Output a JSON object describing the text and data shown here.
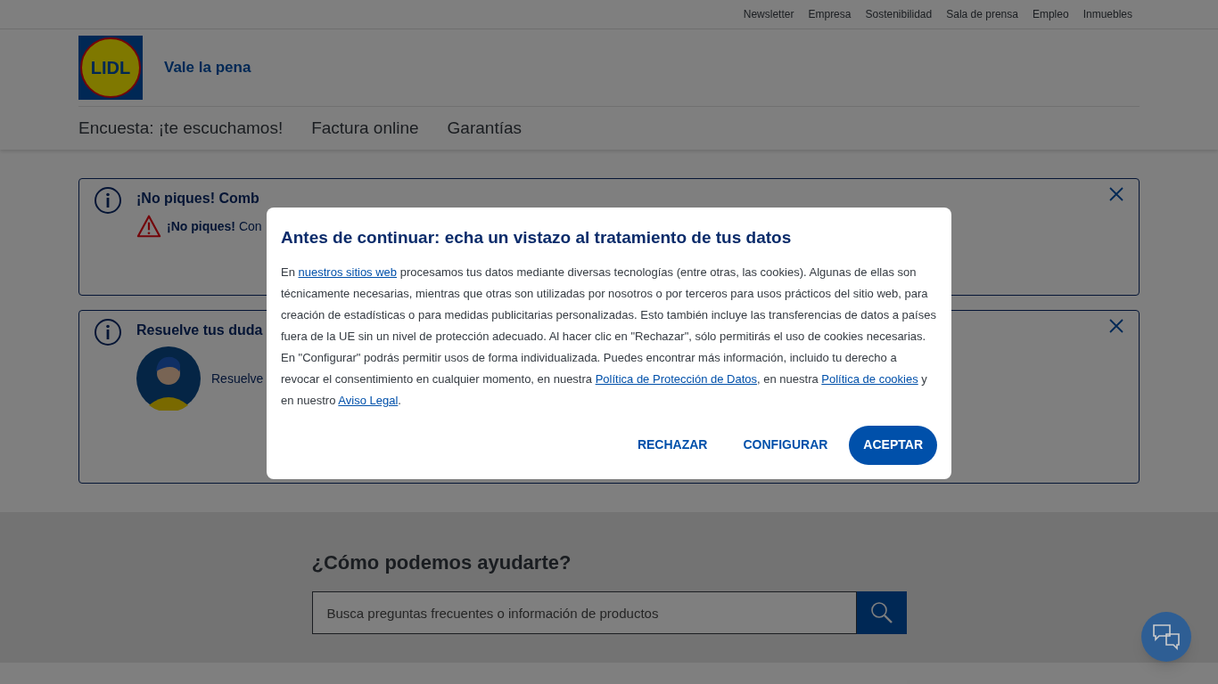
{
  "top_links": [
    "Newsletter",
    "Empresa",
    "Sostenibilidad",
    "Sala de prensa",
    "Empleo",
    "Inmuebles"
  ],
  "logo": {
    "text": "LIDL"
  },
  "tagline": "Vale la pena",
  "nav": [
    "Encuesta: ¡te escuchamos!",
    "Factura online",
    "Garantías"
  ],
  "notices": [
    {
      "kind": "warning",
      "title": "¡No piques! Comb",
      "lead": "¡No piques!",
      "text": "Con"
    },
    {
      "kind": "avatar",
      "title": "Resuelve tus duda",
      "text": "Resuelve"
    }
  ],
  "help": {
    "title": "¿Cómo podemos ayudarte?",
    "placeholder": "Busca preguntas frecuentes o información de productos"
  },
  "dialog": {
    "title": "Antes de continuar: echa un vistazo al tratamiento de tus datos",
    "body": [
      {
        "kind": "text",
        "text": "En "
      },
      {
        "kind": "link",
        "text": "nuestros sitios web"
      },
      {
        "kind": "text",
        "text": " procesamos tus datos mediante diversas tecnologías (entre otras, las cookies). Algunas de ellas son técnicamente necesarias, mientras que otras son utilizadas por nosotros o por terceros para usos prácticos del sitio web, para creación de estadísticas o para medidas publicitarias personalizadas. Esto también incluye las transferencias de datos a países fuera de la UE sin un nivel de protección adecuado. Al hacer clic en \"Rechazar\", sólo permitirás el uso de cookies necesarias. En \"Configurar\" podrás permitir usos de forma individualizada. Puedes encontrar más información, incluido tu derecho a revocar el consentimiento en cualquier momento, en nuestra "
      },
      {
        "kind": "link",
        "text": "Política de Protección de Datos"
      },
      {
        "kind": "text",
        "text": ", en nuestra "
      },
      {
        "kind": "link",
        "text": "Política de cookies"
      },
      {
        "kind": "text",
        "text": " y en nuestro "
      },
      {
        "kind": "link",
        "text": "Aviso Legal"
      },
      {
        "kind": "text",
        "text": "."
      }
    ],
    "buttons": [
      {
        "label": "RECHAZAR",
        "kind": "text"
      },
      {
        "label": "CONFIGURAR",
        "kind": "text"
      },
      {
        "label": "ACEPTAR",
        "kind": "primary"
      }
    ]
  }
}
